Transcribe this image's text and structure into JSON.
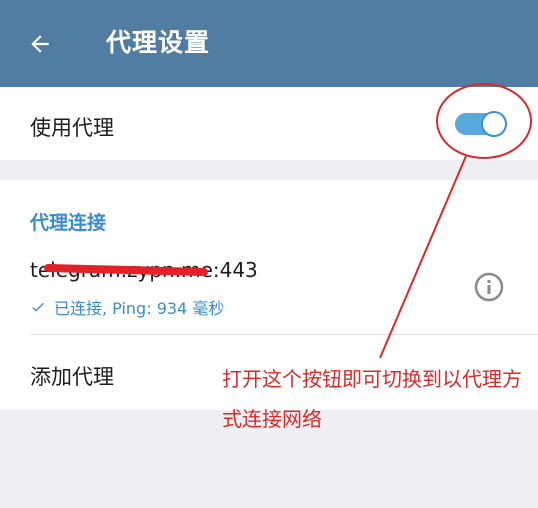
{
  "appbar": {
    "title": "代理设置",
    "back_icon": "arrow-left-icon"
  },
  "use_proxy": {
    "label": "使用代理",
    "enabled": true
  },
  "section": {
    "title": "代理连接",
    "server": "telegram.zypn.me:443",
    "status": "已连接, Ping: 934 毫秒",
    "status_icon": "check-icon",
    "info_icon": "info-icon"
  },
  "add_proxy_label": "添加代理",
  "annotation": {
    "text": "打开这个按钮即可切换到以代理方式连接网络"
  },
  "colors": {
    "appbar": "#517da2",
    "accent": "#3a8cc9",
    "annotation": "#d92a2a",
    "background": "#efeff3"
  }
}
